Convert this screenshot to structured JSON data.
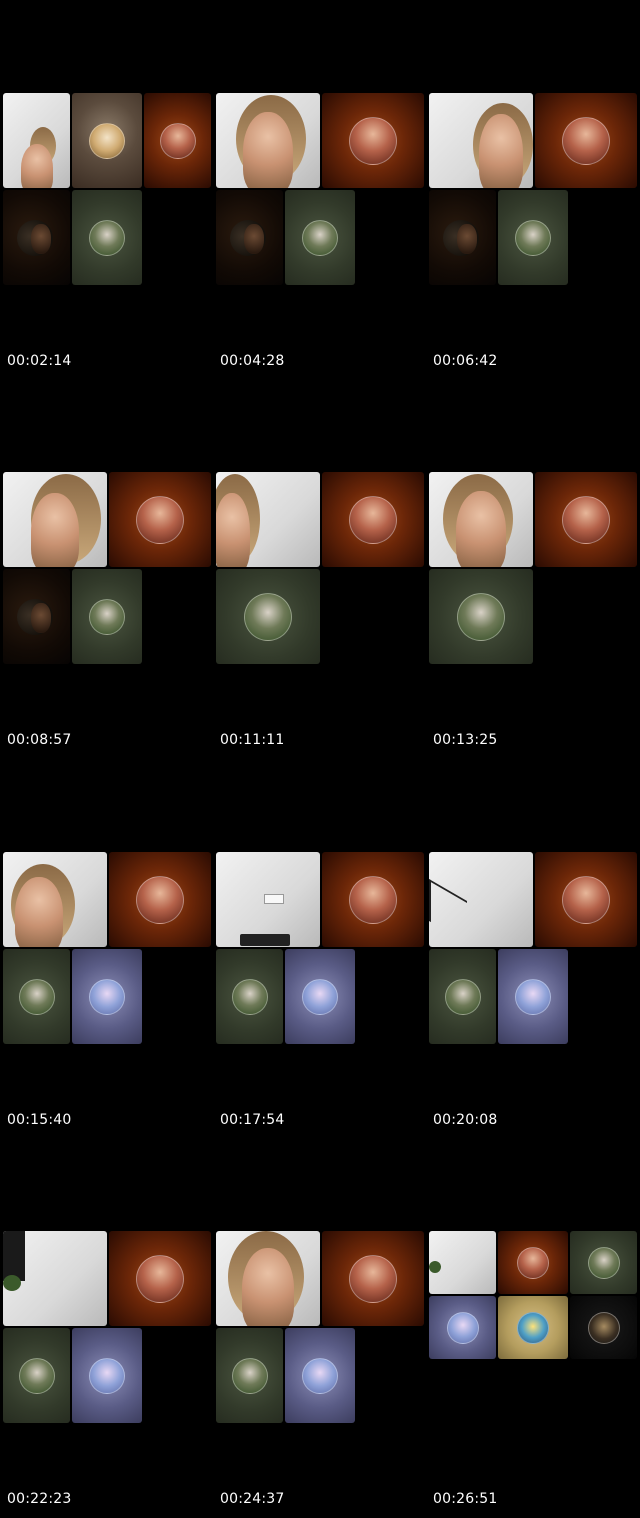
{
  "timestamps": [
    "00:02:14",
    "00:04:28",
    "00:06:42",
    "00:08:57",
    "00:11:11",
    "00:13:25",
    "00:15:40",
    "00:17:54",
    "00:20:08",
    "00:22:23",
    "00:24:37",
    "00:26:51"
  ],
  "colors": {
    "background": "#000000",
    "timestamp_text": "#ffffff"
  }
}
